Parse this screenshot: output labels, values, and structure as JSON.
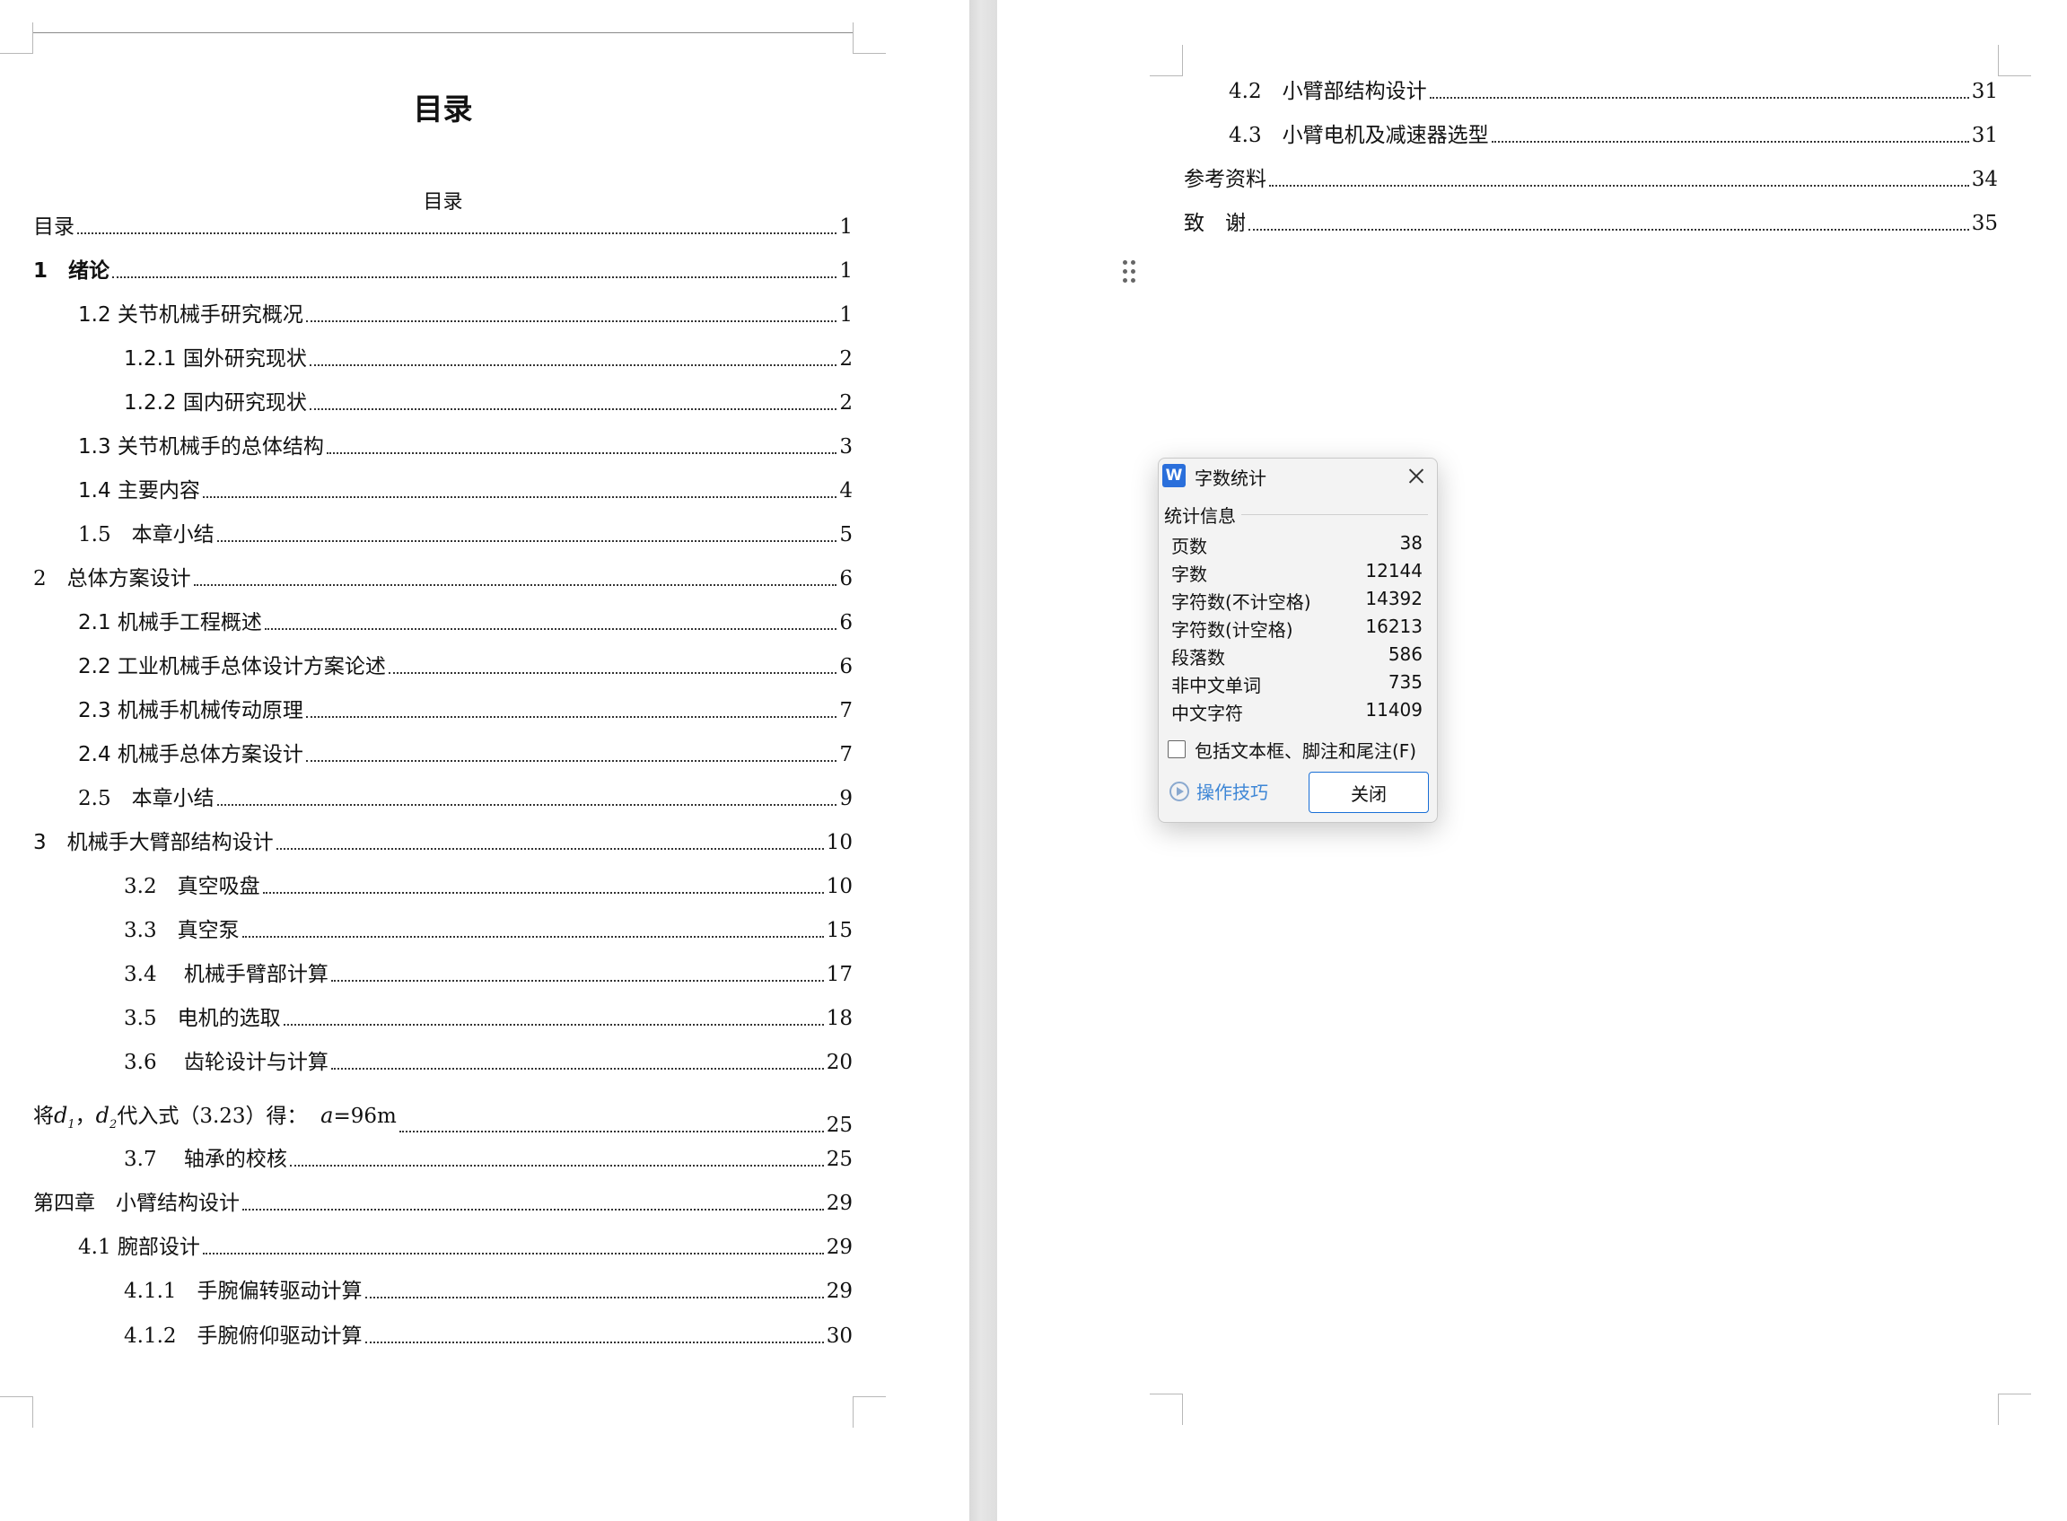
{
  "left_page": {
    "title": "目录",
    "subtitle": "目录",
    "toc": [
      {
        "text": "目录",
        "page": "1"
      },
      {
        "text": "1　绪论",
        "page": "1"
      },
      {
        "text": "1.2 关节机械手研究概况",
        "page": "1"
      },
      {
        "text": "1.2.1 国外研究现状",
        "page": "2"
      },
      {
        "text": "1.2.2 国内研究现状",
        "page": "2"
      },
      {
        "text": "1.3 关节机械手的总体结构",
        "page": "3"
      },
      {
        "text": "1.4 主要内容",
        "page": "4"
      },
      {
        "text": "1.5　本章小结",
        "page": "5"
      },
      {
        "text": "2　总体方案设计",
        "page": "6"
      },
      {
        "text": "2.1 机械手工程概述",
        "page": "6"
      },
      {
        "text": "2.2 工业机械手总体设计方案论述",
        "page": "6"
      },
      {
        "text": "2.3 机械手机械传动原理",
        "page": "7"
      },
      {
        "text": "2.4 机械手总体方案设计",
        "page": "7"
      },
      {
        "text": "2.5　本章小结",
        "page": "9"
      },
      {
        "text": "3　机械手大臂部结构设计",
        "page": "10"
      },
      {
        "text": "3.2　真空吸盘",
        "page": "10"
      },
      {
        "text": "3.3　真空泵",
        "page": "15"
      },
      {
        "text": "3.4　 机械手臂部计算",
        "page": "17"
      },
      {
        "text": "3.5　电机的选取",
        "page": "18"
      },
      {
        "text": "3.6　 齿轮设计与计算",
        "page": "20"
      },
      {
        "text_prefix": "将",
        "math1": "d",
        "sub1": "1",
        "sep": "，",
        "math2": "d",
        "sub2": "2",
        "text_mid": "代入式（3.23）得：",
        "math3": "a",
        "text_suffix": "=96m",
        "page": "25"
      },
      {
        "text": "3.7　 轴承的校核",
        "page": "25"
      },
      {
        "text": "第四章　小臂结构设计",
        "page": "29"
      },
      {
        "text": "4.1 腕部设计",
        "page": "29"
      },
      {
        "text": "4.1.1　手腕偏转驱动计算",
        "page": "29"
      },
      {
        "text": "4.1.2　手腕俯仰驱动计算",
        "page": "30"
      }
    ]
  },
  "right_page": {
    "toc": [
      {
        "text": "4.2　小臂部结构设计",
        "page": "31"
      },
      {
        "text": "4.3　小臂电机及减速器选型",
        "page": "31"
      },
      {
        "text": "参考资料",
        "page": "34"
      },
      {
        "text": "致　谢",
        "page": "35"
      }
    ]
  },
  "word_count_dialog": {
    "logo": "W",
    "title": "字数统计",
    "section": "统计信息",
    "stats": [
      {
        "label": "页数",
        "value": "38"
      },
      {
        "label": "字数",
        "value": "12144"
      },
      {
        "label": "字符数(不计空格)",
        "value": "14392"
      },
      {
        "label": "字符数(计空格)",
        "value": "16213"
      },
      {
        "label": "段落数",
        "value": "586"
      },
      {
        "label": "非中文单词",
        "value": "735"
      },
      {
        "label": "中文字符",
        "value": "11409"
      }
    ],
    "checkbox_label": "包括文本框、脚注和尾注(F)",
    "checkbox_checked": false,
    "tips_label": "操作技巧",
    "close_button": "关闭",
    "accent_color": "#1a6fd6"
  }
}
